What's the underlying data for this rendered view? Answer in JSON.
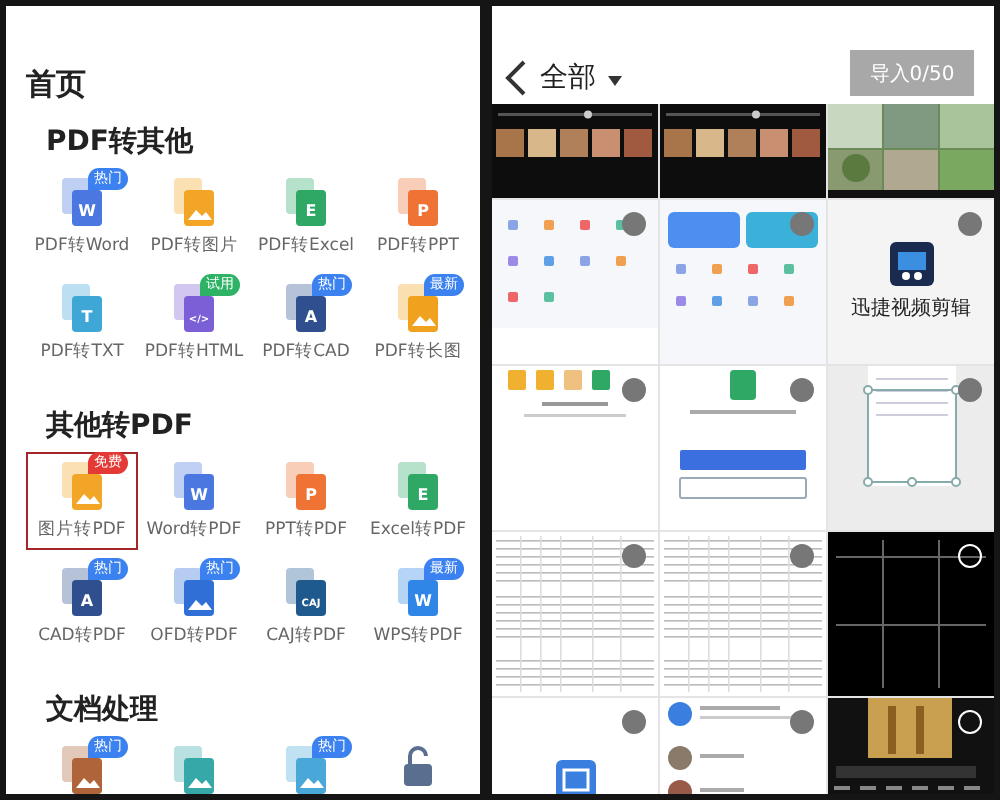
{
  "home": {
    "title": "首页",
    "sections": [
      {
        "title": "PDF转其他",
        "items": [
          {
            "label": "PDF转Word",
            "color": "#4a78e0",
            "glyph": "W",
            "badge": {
              "text": "热门",
              "color": "#3b82f0"
            },
            "highlighted": false
          },
          {
            "label": "PDF转图片",
            "color": "#f2a526",
            "highlighted": false
          },
          {
            "label": "PDF转Excel",
            "color": "#2fa866",
            "glyph": "E",
            "highlighted": false
          },
          {
            "label": "PDF转PPT",
            "color": "#ee7335",
            "glyph": "P",
            "highlighted": false
          },
          {
            "label": "PDF转TXT",
            "color": "#3fa7d6",
            "glyph": "T",
            "highlighted": false
          },
          {
            "label": "PDF转HTML",
            "color": "#7b5fd6",
            "glyph": "</>",
            "badge": {
              "text": "试用",
              "color": "#2eb366"
            },
            "highlighted": false
          },
          {
            "label": "PDF转CAD",
            "color": "#2f4f8f",
            "glyph": "A",
            "badge": {
              "text": "热门",
              "color": "#3b82f0"
            },
            "highlighted": false
          },
          {
            "label": "PDF转长图",
            "color": "#f0a21e",
            "badge": {
              "text": "最新",
              "color": "#3b82f0"
            },
            "highlighted": false
          }
        ]
      },
      {
        "title": "其他转PDF",
        "items": [
          {
            "label": "图片转PDF",
            "color": "#f2a526",
            "badge": {
              "text": "免费",
              "color": "#e53935"
            },
            "highlighted": true
          },
          {
            "label": "Word转PDF",
            "color": "#4a78e0",
            "glyph": "W",
            "highlighted": false
          },
          {
            "label": "PPT转PDF",
            "color": "#ee7335",
            "glyph": "P",
            "highlighted": false
          },
          {
            "label": "Excel转PDF",
            "color": "#2fa866",
            "glyph": "E",
            "highlighted": false
          },
          {
            "label": "CAD转PDF",
            "color": "#2f4f8f",
            "glyph": "A",
            "badge": {
              "text": "热门",
              "color": "#3b82f0"
            },
            "highlighted": false
          },
          {
            "label": "OFD转PDF",
            "color": "#2f6fd6",
            "badge": {
              "text": "热门",
              "color": "#3b82f0"
            },
            "highlighted": false
          },
          {
            "label": "CAJ转PDF",
            "color": "#1f5a8f",
            "glyph": "CAJ",
            "highlighted": false
          },
          {
            "label": "WPS转PDF",
            "color": "#2f86e6",
            "glyph": "W",
            "badge": {
              "text": "最新",
              "color": "#3b82f0"
            },
            "highlighted": false
          }
        ]
      },
      {
        "title": "文档处理",
        "items": [
          {
            "color": "#b0643a",
            "badge": {
              "text": "热门",
              "color": "#3b82f0"
            },
            "highlighted": false
          },
          {
            "color": "#36a8a8",
            "highlighted": false
          },
          {
            "color": "#4aa8d8",
            "badge": {
              "text": "热门",
              "color": "#3b82f0"
            },
            "highlighted": false
          },
          {
            "color": "#5a6f8f",
            "kind": "lock",
            "highlighted": false
          }
        ]
      }
    ]
  },
  "gallery": {
    "album": "全部",
    "import_button": {
      "label": "导入0/50",
      "disabled": true
    },
    "thumbnails": [
      {
        "kind": "video-player"
      },
      {
        "kind": "video-player"
      },
      {
        "kind": "photos"
      },
      {
        "kind": "app-menu",
        "selected": false
      },
      {
        "kind": "app-menu-cards",
        "selected": false
      },
      {
        "kind": "app-logo",
        "caption": "迅捷视频剪辑",
        "selected": false
      },
      {
        "kind": "files",
        "selected": false
      },
      {
        "kind": "excel-file",
        "selected": false
      },
      {
        "kind": "crop",
        "selected": false
      },
      {
        "kind": "table",
        "selected": false
      },
      {
        "kind": "table",
        "selected": false
      },
      {
        "kind": "dark-grid",
        "selected": false
      },
      {
        "kind": "app-icon",
        "selected": false
      },
      {
        "kind": "chat",
        "selected": false
      },
      {
        "kind": "video-editor",
        "selected": false
      }
    ]
  }
}
